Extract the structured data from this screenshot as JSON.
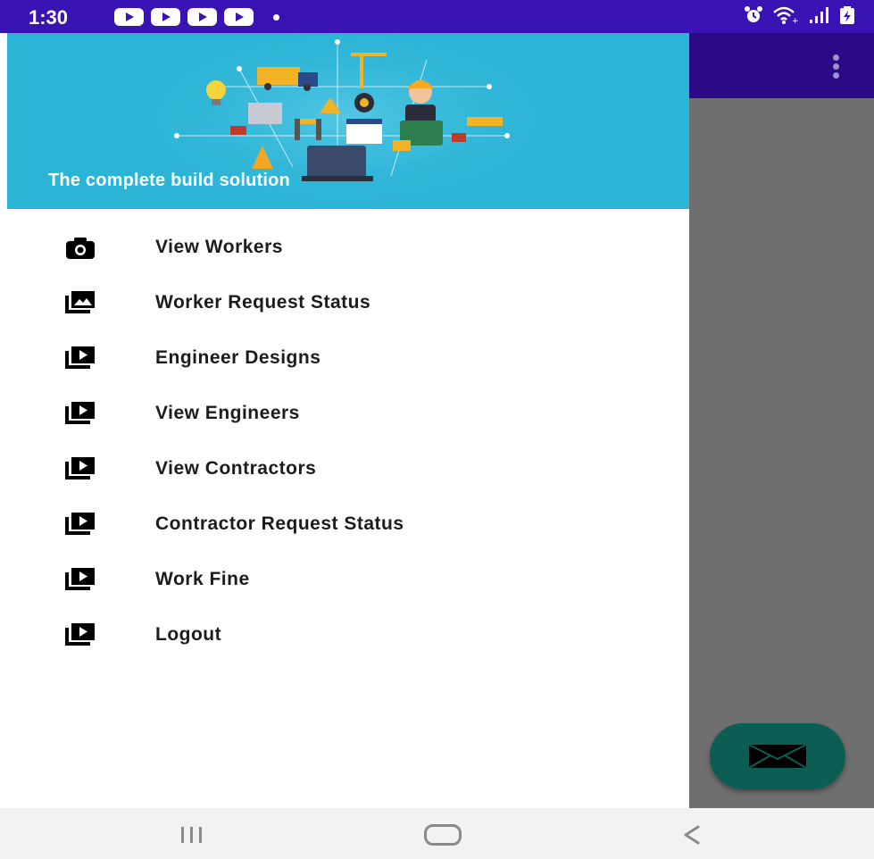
{
  "status_bar": {
    "time": "1:30",
    "notification_icons": [
      "youtube-icon",
      "youtube-icon",
      "youtube-icon",
      "youtube-icon",
      "dot-icon"
    ],
    "system_icons": [
      "alarm-icon",
      "wifi-icon",
      "signal-icon",
      "battery-icon"
    ]
  },
  "drawer": {
    "header": {
      "tagline": "The complete build solution"
    },
    "items": [
      {
        "label": "View Workers",
        "icon": "camera-icon"
      },
      {
        "label": "Worker Request Status",
        "icon": "gallery-icon"
      },
      {
        "label": "Engineer Designs",
        "icon": "video-library-icon"
      },
      {
        "label": "View Engineers",
        "icon": "video-library-icon"
      },
      {
        "label": "View Contractors",
        "icon": "video-library-icon"
      },
      {
        "label": "Contractor Request Status",
        "icon": "video-library-icon"
      },
      {
        "label": "Work Fine",
        "icon": "video-library-icon"
      },
      {
        "label": "Logout",
        "icon": "video-library-icon"
      }
    ]
  },
  "fab": {
    "icon": "mail-icon"
  },
  "nav_bar": {
    "buttons": [
      "recents-button",
      "home-button",
      "back-button"
    ]
  },
  "colors": {
    "status_bar": "#3a13b5",
    "app_bar": "#2c0a86",
    "drawer_header": "#2cb4d6",
    "scrim": "#6f6f6f",
    "fab": "#0c5e55"
  }
}
